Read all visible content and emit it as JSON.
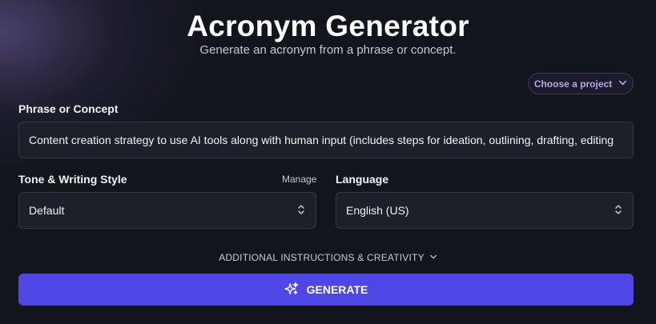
{
  "header": {
    "title": "Acronym Generator",
    "subtitle": "Generate an acronym from a phrase or concept."
  },
  "project_selector": {
    "label": "Choose a project",
    "icon": "chevron-down-icon"
  },
  "phrase": {
    "label": "Phrase or Concept",
    "value": "Content creation strategy to use AI tools along with human input (includes steps for ideation, outlining, drafting, editing"
  },
  "tone": {
    "label": "Tone & Writing Style",
    "manage_label": "Manage",
    "selected": "Default",
    "icon": "select-arrows-icon"
  },
  "language": {
    "label": "Language",
    "selected": "English (US)",
    "icon": "select-arrows-icon"
  },
  "additional": {
    "label": "ADDITIONAL INSTRUCTIONS & CREATIVITY",
    "icon": "chevron-down-icon"
  },
  "generate": {
    "label": "GENERATE",
    "icon": "sparkles-icon"
  },
  "colors": {
    "background": "#13151d",
    "accent": "#4f46e5",
    "project_text": "#b9a6f2",
    "field_bg": "#1c2029"
  }
}
